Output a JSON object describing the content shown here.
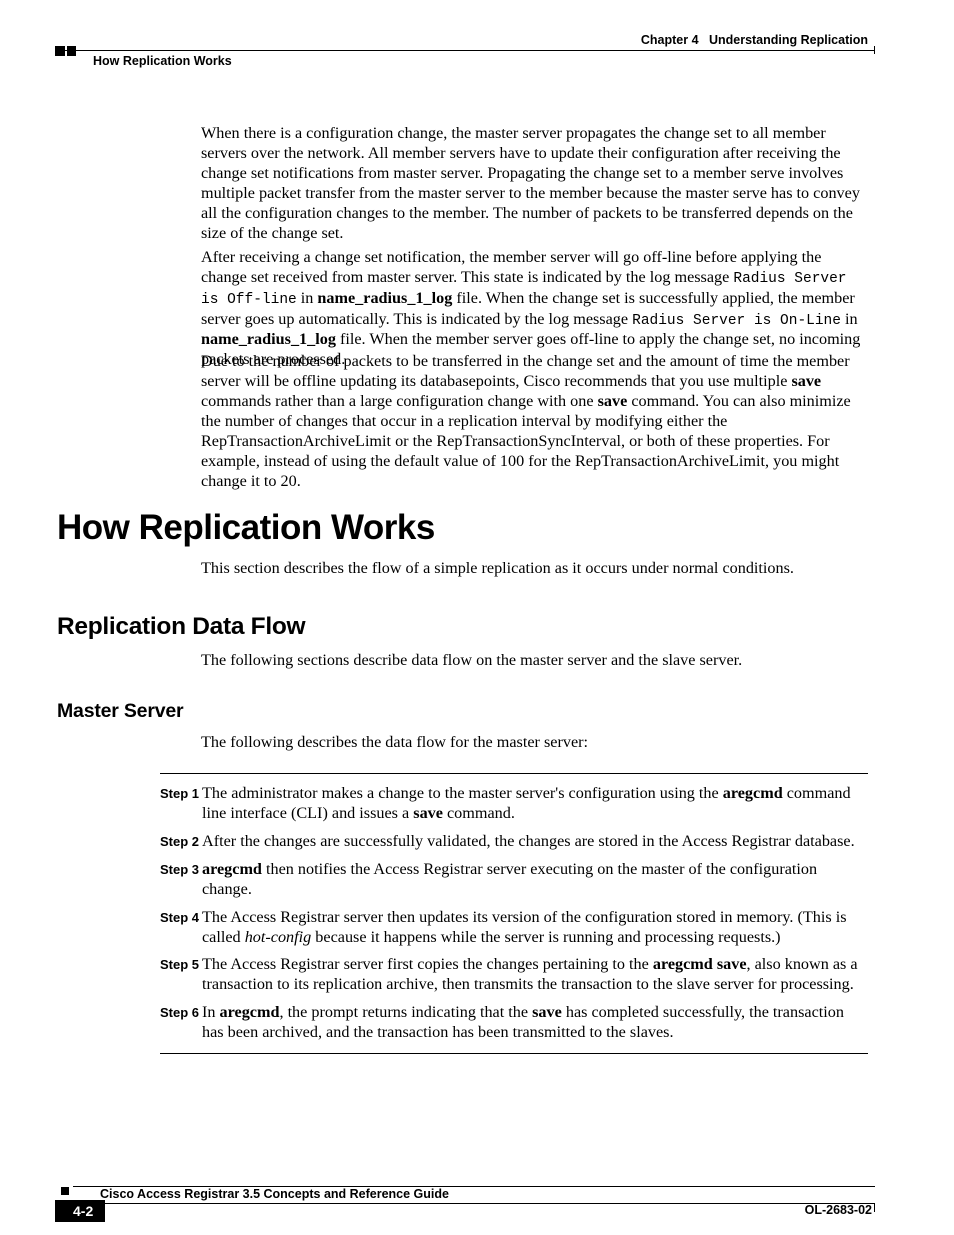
{
  "header": {
    "chapter": "Chapter 4",
    "chapterTitle": "Understanding Replication",
    "sectionLeft": "How Replication Works"
  },
  "para1": {
    "t": "When there is a configuration change, the master server propagates the change set to all member servers over the network. All member servers have to update their configuration after receiving the change set notifications from master server. Propagating the change set to a member serve involves multiple packet transfer from the master server to the member because the master serve has to convey all the configuration changes to the member. The number of  packets to be transferred depends on the size of the change set."
  },
  "para2": {
    "a": "After receiving a change set notification, the member server will go off-line before applying the change set received from master server. This state is indicated by the log message ",
    "m1": "Radius Server is Off-line",
    "b": " in ",
    "f1": "name_radius_1_log",
    "c": " file. When the change set is successfully applied, the member server goes up automatically. This is indicated by the log message ",
    "m2": "Radius Server is On-Line",
    "d": " in ",
    "f2": "name_radius_1_log",
    "e": " file. When the member server goes off-line to apply the change set, no incoming packets are processed."
  },
  "para3": {
    "a": "Due to the number of packets to be transferred in the change set and the amount of time the member server will be offline updating its databasepoints, Cisco recommends that you use multiple ",
    "s1": "save",
    "b": " commands rather than a large configuration change with one ",
    "s2": "save",
    "c": " command. You can also minimize the number of changes that occur in a replication interval by modifying either the RepTransactionArchiveLimit or the RepTransactionSyncInterval, or both of these properties. For example, instead of using the default value of 100 for the RepTransactionArchiveLimit, you might change it to 20."
  },
  "h1": "How Replication Works",
  "p_h1": "This section describes the flow of a simple replication as it occurs under normal conditions.",
  "h2": "Replication Data Flow",
  "p_h2": "The following sections describe data flow on the master server and the slave server.",
  "h3": "Master Server",
  "p_h3": "The following describes the data flow for the master server:",
  "steps": [
    {
      "label": "Step 1",
      "pre": "The administrator makes a change to the master server's configuration using the ",
      "b1": "aregcmd",
      "mid": " command line interface (CLI) and issues a ",
      "b2": "save",
      "post": " command."
    },
    {
      "label": "Step 2",
      "t": "After the changes are successfully validated, the changes are stored in the Access Registrar database."
    },
    {
      "label": "Step 3",
      "b1": "aregcmd",
      "post": " then notifies the Access Registrar server executing on the master of the configuration change."
    },
    {
      "label": "Step 4",
      "pre": "The Access Registrar server then updates its version of the configuration stored in memory. (This is called ",
      "i1": "hot-config",
      "post": " because it happens while the server is running and processing requests.)"
    },
    {
      "label": "Step 5",
      "pre": "The Access Registrar server first copies the changes pertaining to the ",
      "b1": "aregcmd save",
      "post": ", also known as a transaction to its replication archive, then transmits the transaction to the slave server for processing."
    },
    {
      "label": "Step 6",
      "pre": "In ",
      "b1": "aregcmd",
      "mid": ", the prompt returns indicating that the ",
      "b2": "save",
      "post": " has completed successfully, the transaction has been archived, and the transaction has been transmitted to the slaves."
    }
  ],
  "footer": {
    "title": "Cisco Access Registrar 3.5 Concepts and Reference Guide",
    "page": "4-2",
    "code": "OL-2683-02"
  }
}
